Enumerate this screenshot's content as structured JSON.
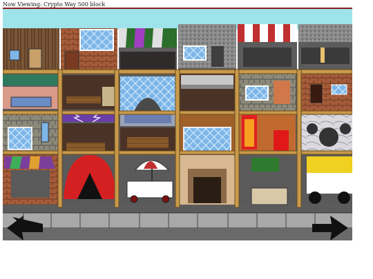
{
  "header": {
    "viewing_label": "Now Viewing: Crypto Way 500 block"
  },
  "navigation": {
    "left_arrow_icon": "arrow-left-icon",
    "right_arrow_icon": "arrow-right-icon"
  },
  "colors": {
    "header_rule": "#8b1a1a",
    "sky": "#9fe3ea",
    "street": "#5a5a5a",
    "sidewalk": "#a8a8a8",
    "wood_frame": "#c89a4a",
    "arrow": "#111111"
  },
  "buildings": [
    {
      "id": "building-1",
      "roof": "brick-brown",
      "floors": [
        "window-row",
        "green-awning-shop",
        "stone-window-facade",
        "colorful-awning-shop"
      ]
    },
    {
      "id": "building-2",
      "roof": "orange-brick-window",
      "floors": [
        "wood-shelf-room",
        "purple-lightning-room",
        "wood-bench-room",
        "red-tent-shop"
      ]
    },
    {
      "id": "building-3",
      "roof": "green-striped-awning",
      "floors": [
        "stone-arch-window",
        "blue-roof-shelf",
        "wood-bench-room",
        "umbrella-cart"
      ]
    },
    {
      "id": "building-4",
      "roof": "gray-stucco-window",
      "floors": [
        "metal-pipe-room",
        "brown-window-facade",
        "stone-fireplace"
      ]
    },
    {
      "id": "building-5",
      "roof": "red-white-awning",
      "floors": [
        "stone-brick-windows",
        "fire-door-room",
        "green-planter-stall"
      ]
    },
    {
      "id": "building-6",
      "roof": "dark-stone-top",
      "floors": [
        "brick-door-window",
        "marble-circles",
        "yellow-food-truck"
      ]
    }
  ]
}
